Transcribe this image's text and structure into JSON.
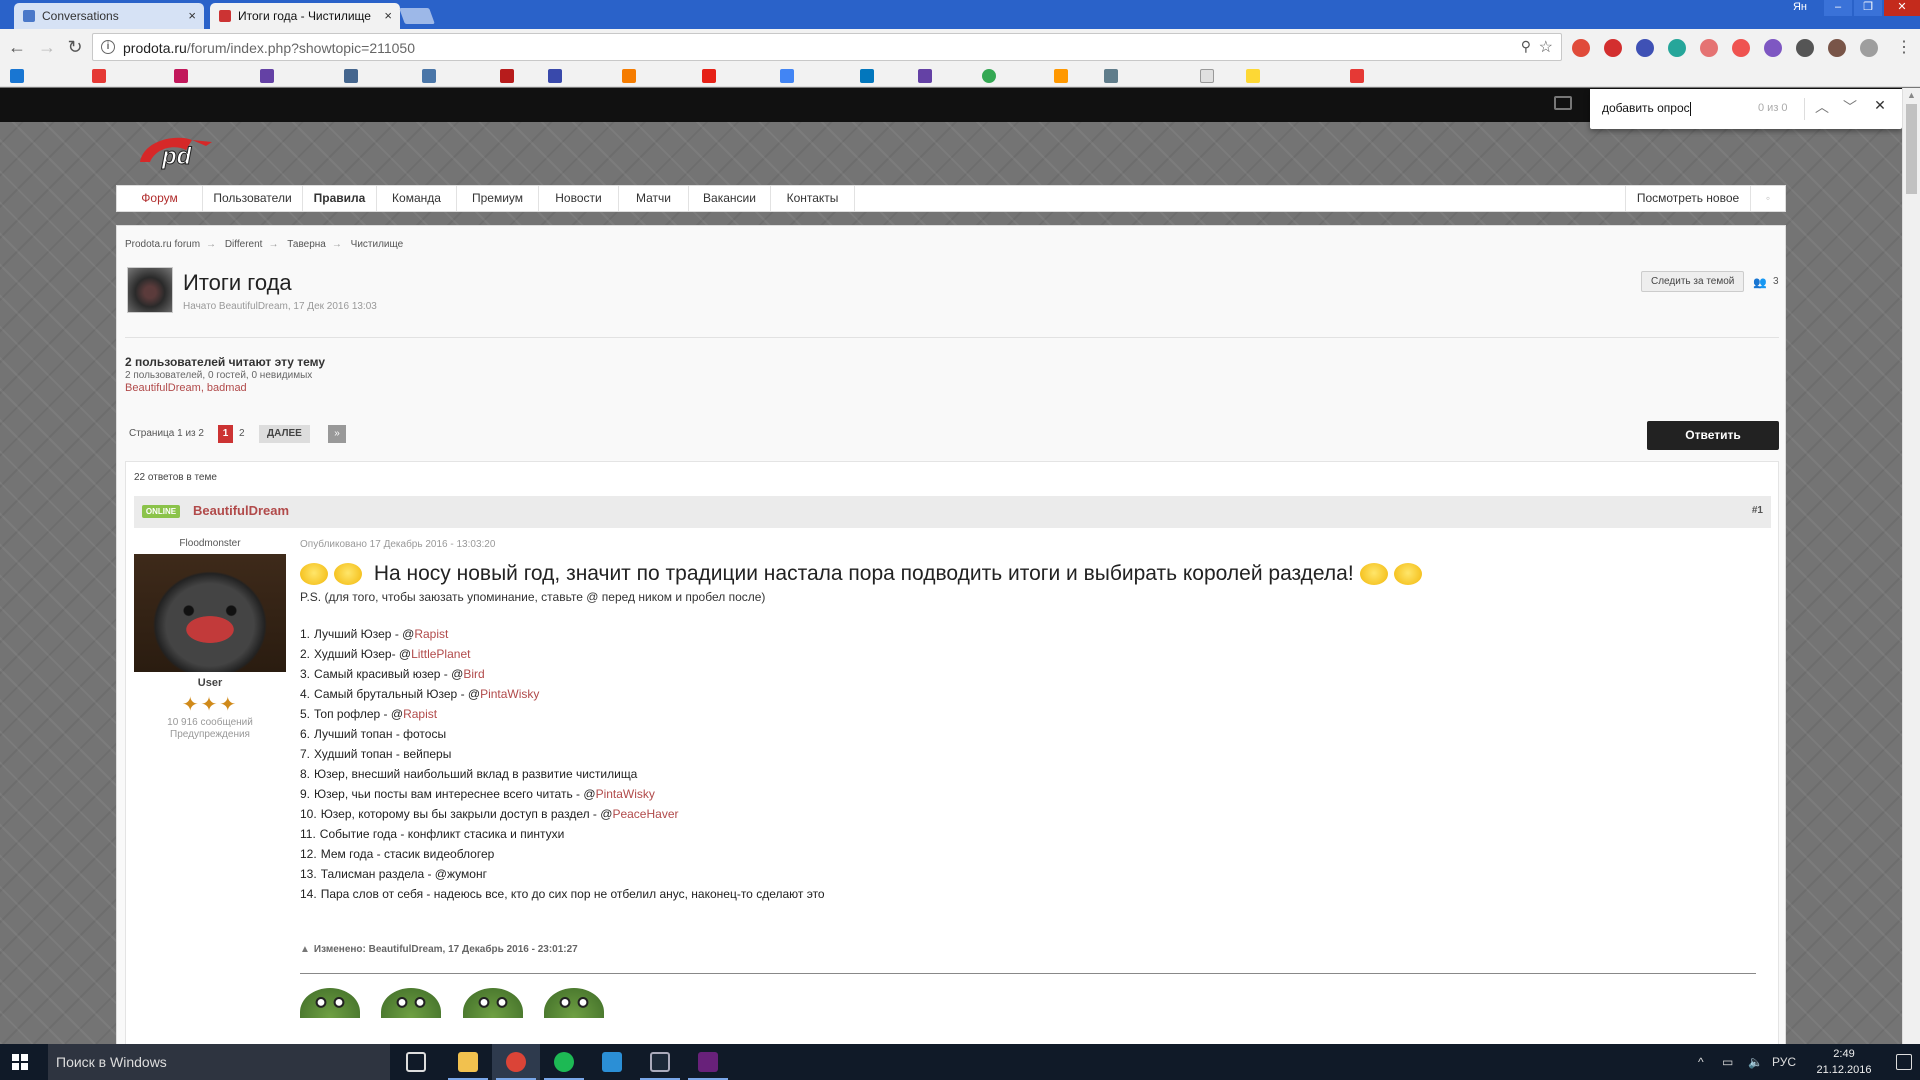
{
  "browser": {
    "tabs": [
      {
        "title": "Conversations",
        "active": false
      },
      {
        "title": "Итоги года - Чистилище",
        "active": true
      }
    ],
    "user_name": "Ян",
    "url_host": "prodota.ru",
    "url_path": "/forum/index.php?showtopic=211050",
    "find_query": "добавить опрос",
    "find_count": "0 из 0"
  },
  "site": {
    "logo_text": "pd",
    "nav": [
      "Форум",
      "Пользователи",
      "Правила",
      "Команда",
      "Премиум",
      "Новости",
      "Матчи",
      "Вакансии",
      "Контакты"
    ],
    "nav_new": "Посмотреть новое"
  },
  "breadcrumb": [
    "Prodota.ru forum",
    "Different",
    "Таверна",
    "Чистилище"
  ],
  "topic": {
    "title": "Итоги года",
    "meta": "Начато BeautifulDream, 17 Дек 2016 13:03",
    "follow_label": "Следить за темой",
    "followers": "3",
    "readers_title": "2 пользователей читают эту тему",
    "readers_sub": "2 пользователей, 0 гостей, 0 невидимых",
    "readers_names": "BeautifulDream, badmad",
    "pagination": {
      "label": "Страница 1 из 2",
      "current": "1",
      "next_page": "2",
      "next_label": "ДАЛЕЕ",
      "last_label": "»"
    },
    "reply_label": "Ответить",
    "replies_count": "22 ответов в теме"
  },
  "post": {
    "online_label": "ONLINE",
    "author": "BeautifulDream",
    "number": "#1",
    "author_title": "Floodmonster",
    "author_group": "User",
    "author_posts": "10 916 сообщений",
    "author_warnings": "Предупреждения",
    "date": "Опубликовано 17 Декабрь 2016 - 13:03:20",
    "headline": "На носу новый год, значит по традиции настала пора подводить итоги и выбирать королей раздела!",
    "ps": "P.S. (для того, чтобы заюзать упоминание, ставьте @ перед ником и пробел после)",
    "items": [
      {
        "n": "1.",
        "text": "Лучший Юзер - @",
        "mention": "Rapist"
      },
      {
        "n": "2.",
        "text": "Худший Юзер- @",
        "mention": "LittlePlanet"
      },
      {
        "n": "3.",
        "text": "Самый красивый юзер - @",
        "mention": "Bird"
      },
      {
        "n": "4.",
        "text": "Самый брутальный Юзер - @",
        "mention": "PintaWisky"
      },
      {
        "n": "5.",
        "text": "Топ рофлер - @",
        "mention": "Rapist"
      },
      {
        "n": "6.",
        "text": "Лучший топан - фотосы",
        "mention": ""
      },
      {
        "n": "7.",
        "text": "Худший топан - вейперы",
        "mention": ""
      },
      {
        "n": "8.",
        "text": "Юзер, внесший наибольший вклад в развитие чистилища",
        "mention": ""
      },
      {
        "n": "9.",
        "text": "Юзер, чьи посты вам интереснее всего читать - @",
        "mention": "PintaWisky"
      },
      {
        "n": "10.",
        "text": "Юзер, которому вы бы закрыли доступ в раздел - @",
        "mention": "PeaceHaver"
      },
      {
        "n": "11.",
        "text": "Событие года - конфликт стасика и пинтухи",
        "mention": ""
      },
      {
        "n": "12.",
        "text": "Мем года - стасик видеоблогер",
        "mention": ""
      },
      {
        "n": "13.",
        "text": "Талисман раздела - @жумонг",
        "mention": ""
      },
      {
        "n": "14.",
        "text": "Пара слов от себя - надеюсь все, кто до сих пор не отбелил анус, наконец-то сделают это",
        "mention": ""
      }
    ],
    "edited": "Изменено: BeautifulDream, 17 Декабрь 2016 - 23:01:27"
  },
  "taskbar": {
    "search_placeholder": "Поиск в Windows",
    "lang": "РУС",
    "time": "2:49",
    "date": "21.12.2016"
  },
  "colors": {
    "accent": "#b14a4a",
    "tabstrip": "#2a62c9",
    "taskbar": "#101a28",
    "online": "#8bc34a"
  },
  "icons": [
    "back-icon",
    "forward-icon",
    "reload-icon",
    "info-icon",
    "zoom-icon",
    "star-icon",
    "mail-icon",
    "windows-start-icon"
  ]
}
